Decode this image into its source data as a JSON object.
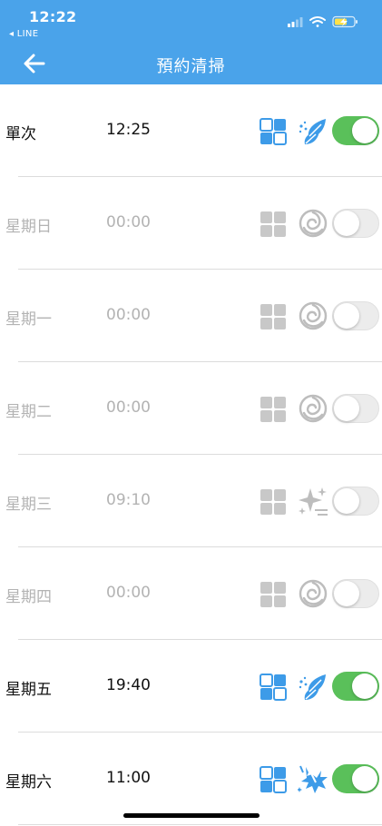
{
  "status_bar": {
    "time": "12:22",
    "back_app": "◂ LINE"
  },
  "header": {
    "title": "預約清掃"
  },
  "colors": {
    "header": "#4aa3ea",
    "toggle_on": "#5ac05a",
    "icon_active": "#3d9be8",
    "icon_inactive": "#c8c8c8"
  },
  "schedules": [
    {
      "day": "單次",
      "time": "12:25",
      "enabled": true,
      "mode_icon": "leaf-icon"
    },
    {
      "day": "星期日",
      "time": "00:00",
      "enabled": false,
      "mode_icon": "swirl-icon"
    },
    {
      "day": "星期一",
      "time": "00:00",
      "enabled": false,
      "mode_icon": "swirl-icon"
    },
    {
      "day": "星期二",
      "time": "00:00",
      "enabled": false,
      "mode_icon": "swirl-icon"
    },
    {
      "day": "星期三",
      "time": "09:10",
      "enabled": false,
      "mode_icon": "sparkle-icon"
    },
    {
      "day": "星期四",
      "time": "00:00",
      "enabled": false,
      "mode_icon": "swirl-icon"
    },
    {
      "day": "星期五",
      "time": "19:40",
      "enabled": true,
      "mode_icon": "leaf-icon"
    },
    {
      "day": "星期六",
      "time": "11:00",
      "enabled": true,
      "mode_icon": "turbo-icon"
    }
  ]
}
